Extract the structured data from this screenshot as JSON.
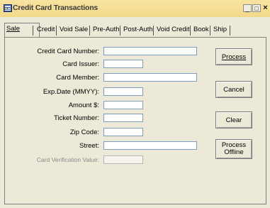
{
  "window": {
    "title": "Credit Card Transactions",
    "minimize": "_",
    "restore": "□",
    "close": "×"
  },
  "tabs": [
    {
      "label": "Sale",
      "active": true
    },
    {
      "label": "Credit"
    },
    {
      "label": "Void Sale"
    },
    {
      "label": "Pre-Auth"
    },
    {
      "label": "Post-Auth"
    },
    {
      "label": "Void Credit"
    },
    {
      "label": "Book"
    },
    {
      "label": "Ship"
    }
  ],
  "form": {
    "card_number_label": "Credit Card Number:",
    "card_number_value": "",
    "card_issuer_label": "Card Issuer:",
    "card_issuer_value": "",
    "card_member_label": "Card Member:",
    "card_member_value": "",
    "exp_date_label": "Exp.Date (MMYY):",
    "exp_date_value": "",
    "amount_label": "Amount $:",
    "amount_value": "",
    "ticket_label": "Ticket Number:",
    "ticket_value": "",
    "zip_label": "Zip Code:",
    "zip_value": "",
    "street_label": "Street:",
    "street_value": "",
    "cvv_label": "Card Verification Value:",
    "cvv_value": ""
  },
  "buttons": {
    "process": "Process",
    "cancel": "Cancel",
    "clear": "Clear",
    "process_offline_line1": "Process",
    "process_offline_line2": "Offline"
  }
}
